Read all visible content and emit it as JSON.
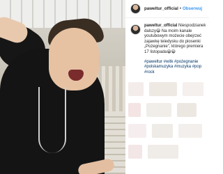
{
  "post": {
    "username": "paweltur_official",
    "separator": "•",
    "follow_label": "Obserwuj",
    "caption": {
      "username": "paweltur_official",
      "text": "Niespodzianek dalszy😁 Na moim kanale youtubowym możecie obejrzeć zajawkę teledysku do piosenki „Pożegnanie”, którego premiera 17 listopada😁😁",
      "hashtags": "#paweltur #witk #pożegnanie #polskamuzyka #muzyka #pop #rock"
    }
  },
  "colors": {
    "link": "#3897f0",
    "hashtag": "#003569",
    "text": "#262626"
  },
  "icons": {
    "avatar": "avatar-photo",
    "photo": "post-photo"
  }
}
